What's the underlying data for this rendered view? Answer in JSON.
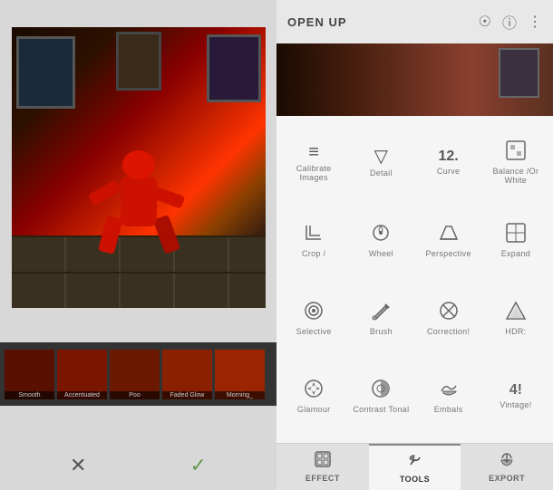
{
  "left_panel": {
    "thumbnails": [
      {
        "label": "Smooth"
      },
      {
        "label": "Accentuated"
      },
      {
        "label": "Poo"
      },
      {
        "label": "Faded Glow"
      },
      {
        "label": "Morning_"
      }
    ],
    "actions": {
      "cancel_label": "✕",
      "confirm_label": "✓"
    }
  },
  "right_panel": {
    "header": {
      "title": "OPEN UP",
      "icons": [
        "wifi",
        "info",
        "more"
      ]
    },
    "tools": [
      {
        "id": "calibrate",
        "icon": "⊞",
        "label": "Calibrate Images"
      },
      {
        "id": "detail",
        "icon": "▽",
        "label": "Detail"
      },
      {
        "id": "curve",
        "icon": "12.",
        "label": "Curve"
      },
      {
        "id": "balance",
        "icon": "⊠",
        "label": "Balance /Or White"
      },
      {
        "id": "crop",
        "icon": "⌧",
        "label": "Crop /"
      },
      {
        "id": "wheel",
        "icon": "↻",
        "label": "Wheel"
      },
      {
        "id": "perspective",
        "icon": "⬡",
        "label": "Perspective"
      },
      {
        "id": "expand",
        "icon": "⊡",
        "label": "Expand"
      },
      {
        "id": "selective",
        "icon": "◎",
        "label": "Selective"
      },
      {
        "id": "brush",
        "icon": "✏",
        "label": "Brush"
      },
      {
        "id": "corrections",
        "icon": "⊗",
        "label": "Correction!"
      },
      {
        "id": "hdr",
        "icon": "▲",
        "label": "HDR:"
      },
      {
        "id": "glamour",
        "icon": "◈",
        "label": "Glamour"
      },
      {
        "id": "contrast_tonal",
        "icon": "⊜",
        "label": "Contrast Tonal"
      },
      {
        "id": "embals",
        "icon": "☁",
        "label": "Embals"
      },
      {
        "id": "vintage",
        "icon": "4!",
        "label": "Vintage!"
      }
    ],
    "tabs": [
      {
        "id": "effect",
        "icon": "⊞",
        "label": "EFFECT",
        "active": false
      },
      {
        "id": "tools",
        "icon": "~",
        "label": "TOOLS",
        "active": true
      },
      {
        "id": "export",
        "icon": "🌿",
        "label": "EXPORT",
        "active": false
      }
    ]
  }
}
